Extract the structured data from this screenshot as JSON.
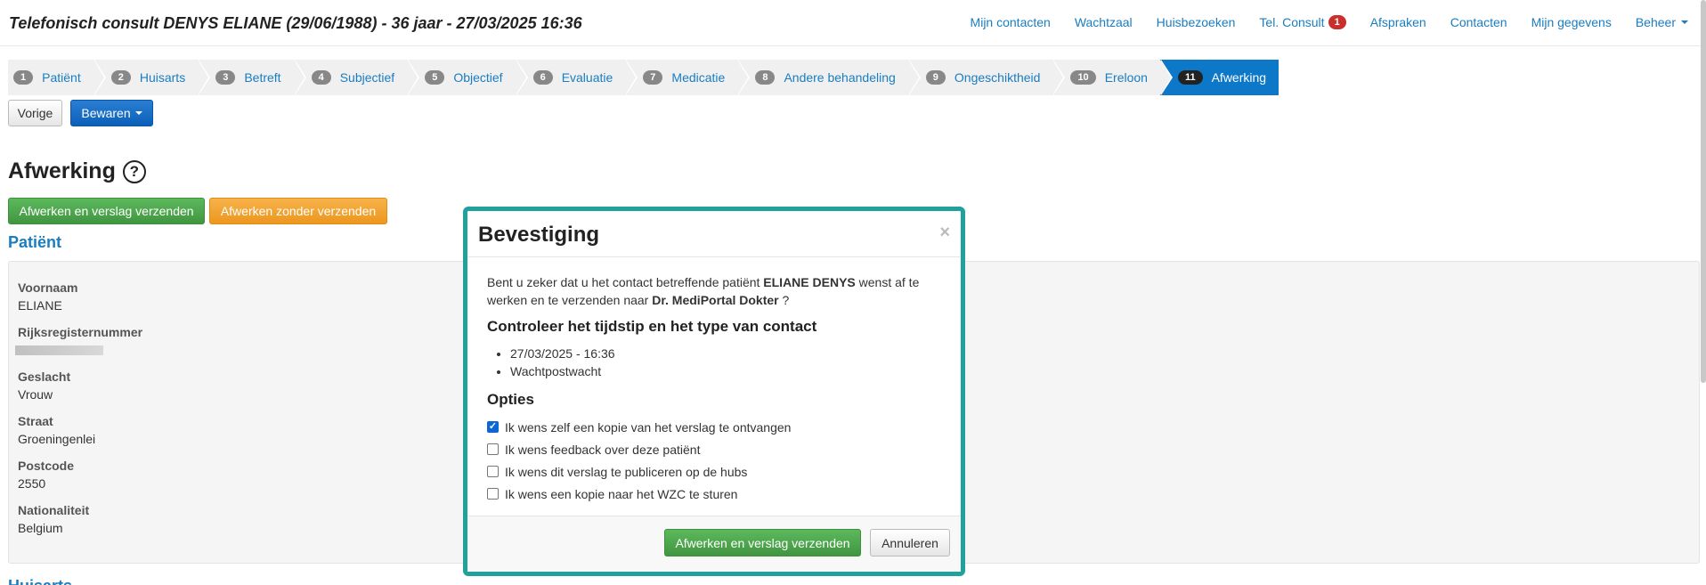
{
  "header": {
    "title": "Telefonisch consult DENYS ELIANE (29/06/1988) - 36 jaar - 27/03/2025 16:36",
    "nav": [
      {
        "label": "Mijn contacten"
      },
      {
        "label": "Wachtzaal"
      },
      {
        "label": "Huisbezoeken"
      },
      {
        "label": "Tel. Consult",
        "badge": "1"
      },
      {
        "label": "Afspraken"
      },
      {
        "label": "Contacten"
      },
      {
        "label": "Mijn gegevens"
      },
      {
        "label": "Beheer",
        "dropdown": true
      }
    ]
  },
  "steps": [
    {
      "num": "1",
      "label": "Patiënt"
    },
    {
      "num": "2",
      "label": "Huisarts"
    },
    {
      "num": "3",
      "label": "Betreft"
    },
    {
      "num": "4",
      "label": "Subjectief"
    },
    {
      "num": "5",
      "label": "Objectief"
    },
    {
      "num": "6",
      "label": "Evaluatie"
    },
    {
      "num": "7",
      "label": "Medicatie"
    },
    {
      "num": "8",
      "label": "Andere behandeling"
    },
    {
      "num": "9",
      "label": "Ongeschiktheid"
    },
    {
      "num": "10",
      "label": "Ereloon"
    },
    {
      "num": "11",
      "label": "Afwerking",
      "active": true
    }
  ],
  "toolbar": {
    "prev_label": "Vorige",
    "save_label": "Bewaren"
  },
  "main": {
    "title": "Afwerking",
    "help_glyph": "?",
    "finish_send_label": "Afwerken en verslag verzenden",
    "finish_nosend_label": "Afwerken zonder verzenden",
    "patient_section": "Patiënt",
    "next_section": "Huisarts"
  },
  "patient": {
    "first_name_label": "Voornaam",
    "first_name": "ELIANE",
    "rrn_label": "Rijksregisternummer",
    "gender_label": "Geslacht",
    "gender": "Vrouw",
    "street_label": "Straat",
    "street": "Groeningenlei",
    "postcode_label": "Postcode",
    "postcode": "2550",
    "nationality_label": "Nationaliteit",
    "nationality": "Belgium"
  },
  "modal": {
    "title": "Bevestiging",
    "close": "×",
    "intro_a": "Bent u zeker dat u het contact betreffende patiënt ",
    "patient_name": "ELIANE DENYS",
    "intro_b": " wenst af te werken en te verzenden naar ",
    "doctor": "Dr. MediPortal Dokter",
    "intro_c": " ?",
    "check_heading": "Controleer het tijdstip en het type van contact",
    "contact_datetime": "27/03/2025 - 16:36",
    "contact_type": "Wachtpostwacht",
    "options_heading": "Opties",
    "options": [
      {
        "label": "Ik wens zelf een kopie van het verslag te ontvangen",
        "checked": true
      },
      {
        "label": "Ik wens feedback over deze patiënt",
        "checked": false
      },
      {
        "label": "Ik wens dit verslag te publiceren op de hubs",
        "checked": false
      },
      {
        "label": "Ik wens een kopie naar het WZC te sturen",
        "checked": false
      }
    ],
    "confirm_label": "Afwerken en verslag verzenden",
    "cancel_label": "Annuleren"
  },
  "colors": {
    "link": "#1a7dc0",
    "active_step": "#0d77c8",
    "modal_border": "#21a19c",
    "badge": "#c9302c"
  }
}
